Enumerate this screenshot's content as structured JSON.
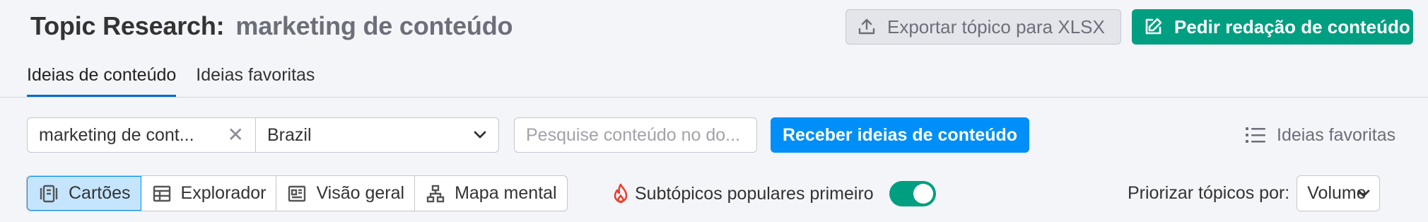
{
  "header": {
    "title": "Topic Research:",
    "topic": "marketing de conteúdo",
    "export_button": "Exportar tópico para XLSX",
    "order_button": "Pedir redação de conteúdo"
  },
  "tabs": [
    {
      "label": "Ideias de conteúdo",
      "active": true
    },
    {
      "label": "Ideias favoritas",
      "active": false
    }
  ],
  "search": {
    "keyword_value": "marketing de cont...",
    "database_value": "Brazil",
    "content_search_placeholder": "Pesquise conteúdo no do...",
    "get_ideas_button": "Receber ideias de conteúdo",
    "favorites_link": "Ideias favoritas"
  },
  "views": [
    {
      "label": "Cartões",
      "icon": "cards-icon",
      "active": true
    },
    {
      "label": "Explorador",
      "icon": "table-icon",
      "active": false
    },
    {
      "label": "Visão geral",
      "icon": "overview-icon",
      "active": false
    },
    {
      "label": "Mapa mental",
      "icon": "mindmap-icon",
      "active": false
    }
  ],
  "toggle": {
    "label": "Subtópicos populares primeiro",
    "on": true,
    "icon": "fire-icon"
  },
  "prioritize": {
    "label": "Priorizar tópicos por:",
    "value": "Volume"
  },
  "colors": {
    "green": "#009f81",
    "blue": "#008ff8",
    "active_view_bg": "#c5e5fe",
    "tab_underline": "#006dca"
  }
}
